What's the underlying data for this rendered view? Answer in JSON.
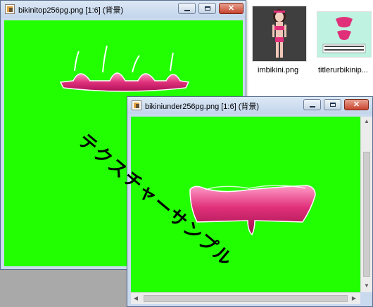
{
  "window_top": {
    "title": "bikinitop256pg.png [1:6] (背景)",
    "controls": {
      "minimize": "‒",
      "maximize": "□",
      "close": "✕"
    }
  },
  "window_under": {
    "title": "bikiniunder256pg.png [1:6] (背景)",
    "controls": {
      "minimize": "‒",
      "maximize": "□",
      "close": "✕"
    }
  },
  "files": [
    {
      "name": "imbikini.png",
      "icon": "character-thumbnail"
    },
    {
      "name": "titlerurbikinip...",
      "icon": "bikini-texture-thumbnail"
    }
  ],
  "overlay_text": "テクスチャーサンプル",
  "colors": {
    "canvas": "#22ff00",
    "bikini": "#e0307a",
    "titlebar": "#c9d9ee"
  }
}
